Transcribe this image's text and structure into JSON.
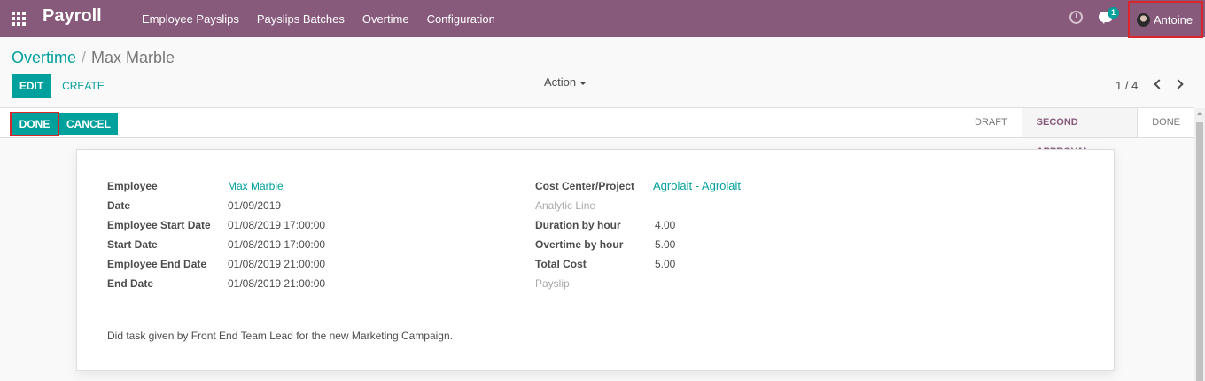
{
  "navbar": {
    "brand": "Payroll",
    "menu": [
      "Employee Payslips",
      "Payslips Batches",
      "Overtime",
      "Configuration"
    ],
    "chat_badge": "1",
    "user_name": "Antoine"
  },
  "breadcrumb": {
    "parent": "Overtime",
    "separator": "/",
    "current": "Max Marble"
  },
  "toolbar": {
    "edit_label": "EDIT",
    "create_label": "CREATE",
    "action_label": "Action",
    "pager": "1 / 4"
  },
  "statusbar": {
    "done_label": "DONE",
    "cancel_label": "CANCEL",
    "stages": [
      "DRAFT",
      "SECOND APPROVAL",
      "DONE"
    ],
    "active_stage": "SECOND APPROVAL"
  },
  "form": {
    "left": [
      {
        "label": "Employee",
        "value": "Max Marble"
      },
      {
        "label": "Date",
        "value": "01/09/2019"
      },
      {
        "label": "Employee Start Date",
        "value": "01/08/2019 17:00:00"
      },
      {
        "label": "Start Date",
        "value": "01/08/2019 17:00:00"
      },
      {
        "label": "Employee End Date",
        "value": "01/08/2019 21:00:00"
      },
      {
        "label": "End Date",
        "value": "01/08/2019 21:00:00"
      }
    ],
    "right": [
      {
        "label": "Cost Center/Project",
        "value": "Agrolait - Agrolait"
      },
      {
        "label": "Analytic Line",
        "value": ""
      },
      {
        "label": "Duration by hour",
        "value": "4.00"
      },
      {
        "label": "Overtime by hour",
        "value": "5.00"
      },
      {
        "label": "Total Cost",
        "value": "5.00"
      },
      {
        "label": "Payslip",
        "value": ""
      }
    ],
    "description": "Did task given by Front End Team Lead for the new Marketing Campaign."
  },
  "colors": {
    "navbar": "#875a7b",
    "accent": "#00a09d",
    "highlight_border": "#d9262c"
  }
}
